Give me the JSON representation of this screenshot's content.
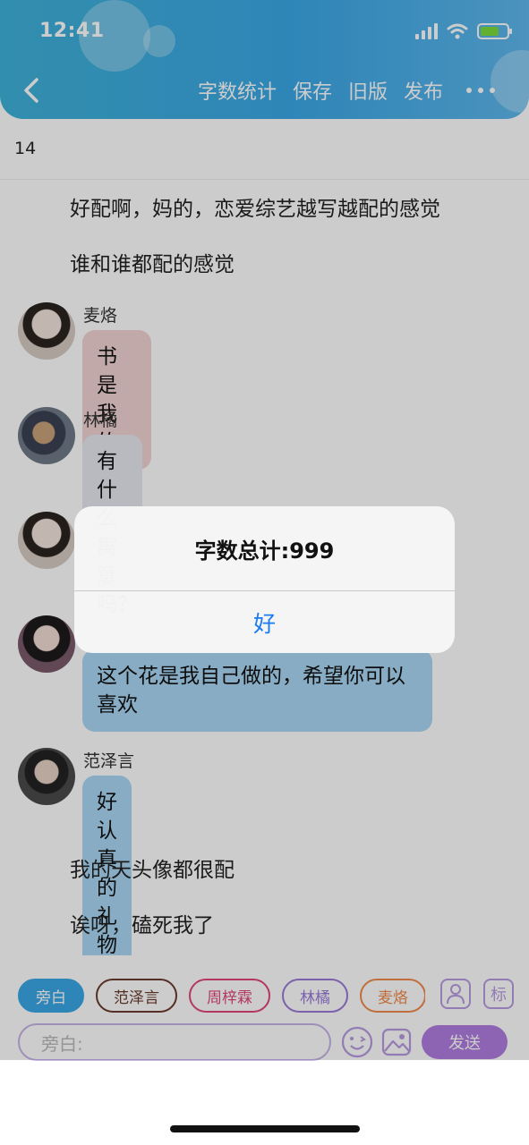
{
  "status_bar": {
    "time": "12:41",
    "icons": [
      "signal-icon",
      "wifi-icon",
      "battery-charging-icon"
    ]
  },
  "nav": {
    "back_icon": "chevron-left-icon",
    "actions": [
      "字数统计",
      "保存",
      "旧版",
      "发布"
    ],
    "more_icon": "more-dots-icon"
  },
  "chapter": {
    "number": "14"
  },
  "messages": [
    {
      "type": "narration",
      "text": "好配啊，妈的，恋爱综艺越写越配的感觉"
    },
    {
      "type": "narration",
      "text": "谁和谁都配的感觉"
    },
    {
      "type": "chat",
      "sender": "麦烙",
      "text": "书是我的...",
      "bubble_color": "#f1d4d2"
    },
    {
      "type": "chat",
      "sender": "林橘",
      "text": "有什么寓意吗?",
      "bubble_color": "#e6e9f1"
    },
    {
      "type": "chat",
      "sender": "",
      "text": "",
      "bubble_color": ""
    },
    {
      "type": "chat",
      "sender": "",
      "text": "这个花是我自己做的，希望你可以喜欢",
      "bubble_color": "#a9d8f6"
    },
    {
      "type": "chat",
      "sender": "范泽言",
      "text": "好认真的礼物",
      "bubble_color": "#a9d8f6"
    },
    {
      "type": "narration",
      "text": "我的天头像都很配"
    },
    {
      "type": "narration",
      "text": "诶呀，磕死我了"
    }
  ],
  "dialog": {
    "title": "字数总计:999",
    "confirm_label": "好"
  },
  "composer": {
    "roles": [
      {
        "label": "旁白",
        "color": "#3aa8e6",
        "selected": true
      },
      {
        "label": "范泽言",
        "color": "#6b3a2e",
        "selected": false
      },
      {
        "label": "周梓霖",
        "color": "#e0457a",
        "selected": false
      },
      {
        "label": "林橘",
        "color": "#9a7ad8",
        "selected": false
      },
      {
        "label": "麦烙",
        "color": "#f08a4b",
        "selected": false
      }
    ],
    "tools": {
      "character_icon": "person-icon",
      "tag_label": "标"
    },
    "input_placeholder": "旁白:",
    "emoji_icon": "emoji-icon",
    "image_icon": "image-icon",
    "send_label": "发送"
  },
  "colors": {
    "header_accent": "#3aa8e6",
    "send": "#b07ee0",
    "dialog_button": "#1a7cf0"
  }
}
